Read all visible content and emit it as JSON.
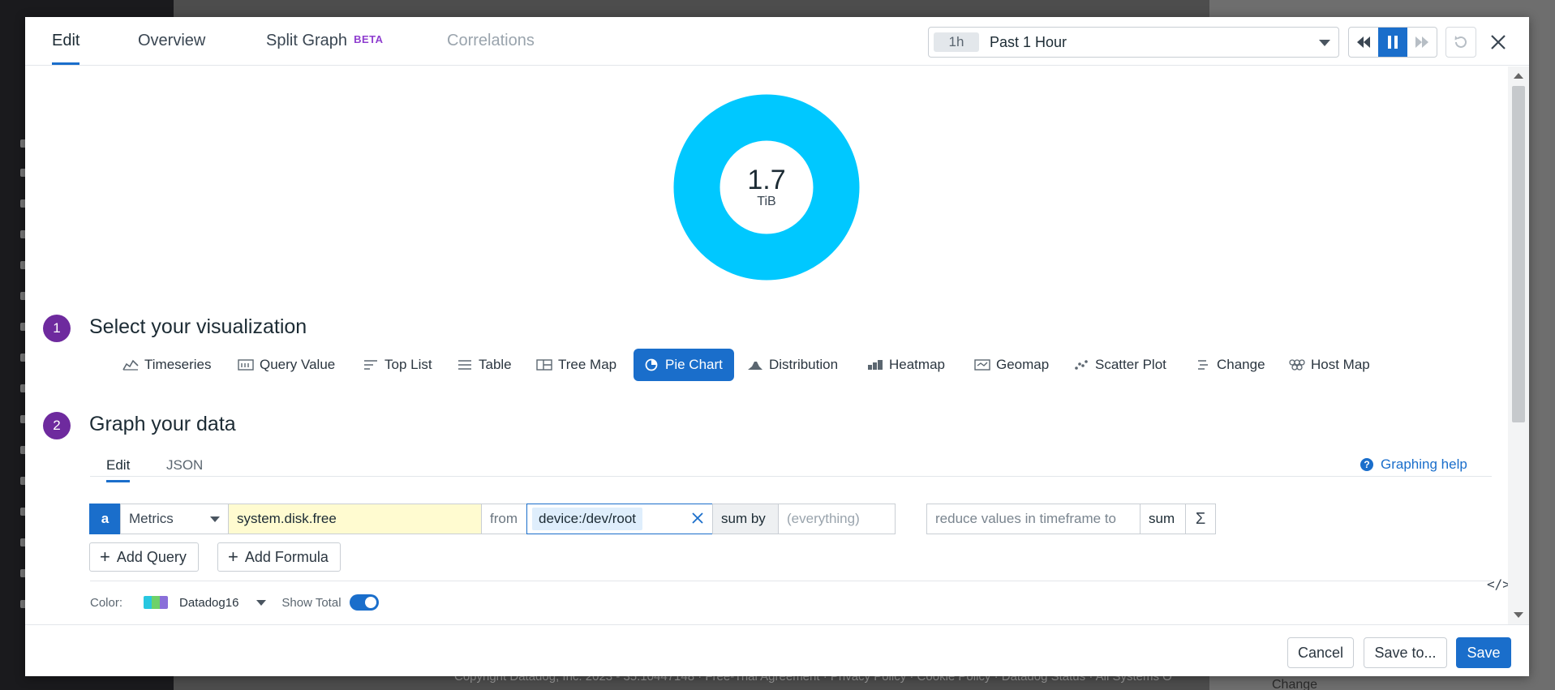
{
  "background": {
    "footer_text": "Copyright Datadog, Inc. 2023 - 35.10447148 · Free-Trial Agreement · Privacy Policy · Cookie Policy · Datadog Status · All Systems O",
    "right_panel_item": "Change"
  },
  "header": {
    "tabs": [
      {
        "label": "Edit",
        "state": "active"
      },
      {
        "label": "Overview",
        "state": "normal"
      },
      {
        "label": "Split Graph",
        "badge": "BETA",
        "state": "normal"
      },
      {
        "label": "Correlations",
        "state": "disabled"
      }
    ],
    "timeframe": {
      "badge": "1h",
      "label": "Past 1 Hour"
    }
  },
  "preview": {
    "value": "1.7",
    "unit": "TiB",
    "slice_color": "#00c8ff",
    "slice_fraction": 1.0
  },
  "step1": {
    "number": "1",
    "title": "Select your visualization"
  },
  "visualizations": [
    {
      "label": "Timeseries",
      "icon": "timeseries-icon"
    },
    {
      "label": "Query Value",
      "icon": "query-value-icon"
    },
    {
      "label": "Top List",
      "icon": "top-list-icon"
    },
    {
      "label": "Table",
      "icon": "table-icon"
    },
    {
      "label": "Tree Map",
      "icon": "tree-map-icon"
    },
    {
      "label": "Pie Chart",
      "icon": "pie-chart-icon",
      "selected": true
    },
    {
      "label": "Distribution",
      "icon": "distribution-icon"
    },
    {
      "label": "Heatmap",
      "icon": "heatmap-icon"
    },
    {
      "label": "Geomap",
      "icon": "geomap-icon"
    },
    {
      "label": "Scatter Plot",
      "icon": "scatter-plot-icon"
    },
    {
      "label": "Change",
      "icon": "change-icon"
    },
    {
      "label": "Host Map",
      "icon": "host-map-icon"
    }
  ],
  "step2": {
    "number": "2",
    "title": "Graph your data"
  },
  "editor": {
    "tabs": [
      {
        "label": "Edit",
        "state": "active"
      },
      {
        "label": "JSON",
        "state": "normal"
      }
    ],
    "help_label": "Graphing help",
    "query": {
      "letter": "a",
      "source": "Metrics",
      "metric": "system.disk.free",
      "from_label": "from",
      "tag": "device:/dev/root",
      "sum_by_label": "sum by",
      "sum_by_placeholder": "(everything)",
      "reduce_label": "reduce values in timeframe to",
      "reduce_value": "sum",
      "sigma": "Σ"
    },
    "add_query_label": "Add Query",
    "add_formula_label": "Add Formula",
    "code_toggle": "</>"
  },
  "options": {
    "color_label": "Color:",
    "palette_name": "Datadog16",
    "palette_colors": [
      "#28c7e0",
      "#6ed16a",
      "#8a6fd9"
    ],
    "show_total_label": "Show Total",
    "show_total_on": true
  },
  "footer": {
    "cancel_label": "Cancel",
    "save_to_label": "Save to...",
    "save_label": "Save"
  }
}
